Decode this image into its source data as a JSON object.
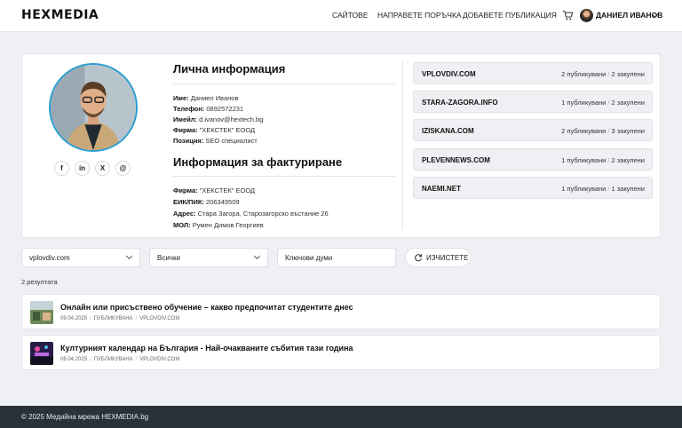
{
  "header": {
    "logo": "HEXMEDIA",
    "nav": [
      "САЙТОВЕ",
      "НАПРАВЕТЕ ПОРЪЧКА",
      "ДОБАВЕТЕ ПУБЛИКАЦИЯ"
    ],
    "user_name": "ДАНИЕЛ ИВАНОВ"
  },
  "profile": {
    "personal_title": "Лична информация",
    "personal": [
      {
        "label": "Име:",
        "value": "Даниел Иванов"
      },
      {
        "label": "Телефон:",
        "value": "0892572231"
      },
      {
        "label": "Имейл:",
        "value": "d.ivanov@hextech.bg"
      },
      {
        "label": "Фирма:",
        "value": "\"ХЕКСТЕК\" ЕООД"
      },
      {
        "label": "Позиция:",
        "value": "SEO специалист"
      }
    ],
    "billing_title": "Информация за фактуриране",
    "billing": [
      {
        "label": "Фирма:",
        "value": "\"ХЕКСТЕК\" ЕООД"
      },
      {
        "label": "ЕИК/ПИК:",
        "value": "206349509"
      },
      {
        "label": "Адрес:",
        "value": "Стара Загора, Старозагорско въстание 26"
      },
      {
        "label": "МОЛ:",
        "value": "Румен Димов Георгиев"
      }
    ],
    "socials": [
      "f",
      "in",
      "X",
      "@"
    ]
  },
  "sites": [
    {
      "name": "VPLOVDIV.COM",
      "published": "2 публикувани",
      "purchased": "2 закупени"
    },
    {
      "name": "STARA-ZAGORA.INFO",
      "published": "1 публикувани",
      "purchased": "2 закупени"
    },
    {
      "name": "IZISKANA.COM",
      "published": "2 публикувани",
      "purchased": "3 закупени"
    },
    {
      "name": "PLEVENNEWS.COM",
      "published": "1 публикувани",
      "purchased": "2 закупени"
    },
    {
      "name": "NAEMI.NET",
      "published": "1 публикувани",
      "purchased": "1 закупени"
    }
  ],
  "filters": {
    "site_select": "vplovdiv.com",
    "status_select": "Всички",
    "keywords_placeholder": "Ключови думи",
    "clear_label": "ИЗЧИСТЕТЕ"
  },
  "results": {
    "count": "2 резултата",
    "items": [
      {
        "title": "Онлайн или присъствено обучение – какво предпочитат студентите днес",
        "date": "09.04.2025",
        "status": "ПУБЛИКУВАНА",
        "site": "VPLOVDIV.COM"
      },
      {
        "title": "Културният календар на България - Най-очакваните събития тази година",
        "date": "06.04.2025",
        "status": "ПУБЛИКУВАНА",
        "site": "VPLOVDIV.COM"
      }
    ]
  },
  "footer": {
    "text": "© 2025 Медийна мрежа HEXMEDIA.bg"
  },
  "colors": {
    "accent_ring": "#2a9fd0",
    "footer_bg": "#2a3239",
    "page_bg": "#eff0f3"
  }
}
